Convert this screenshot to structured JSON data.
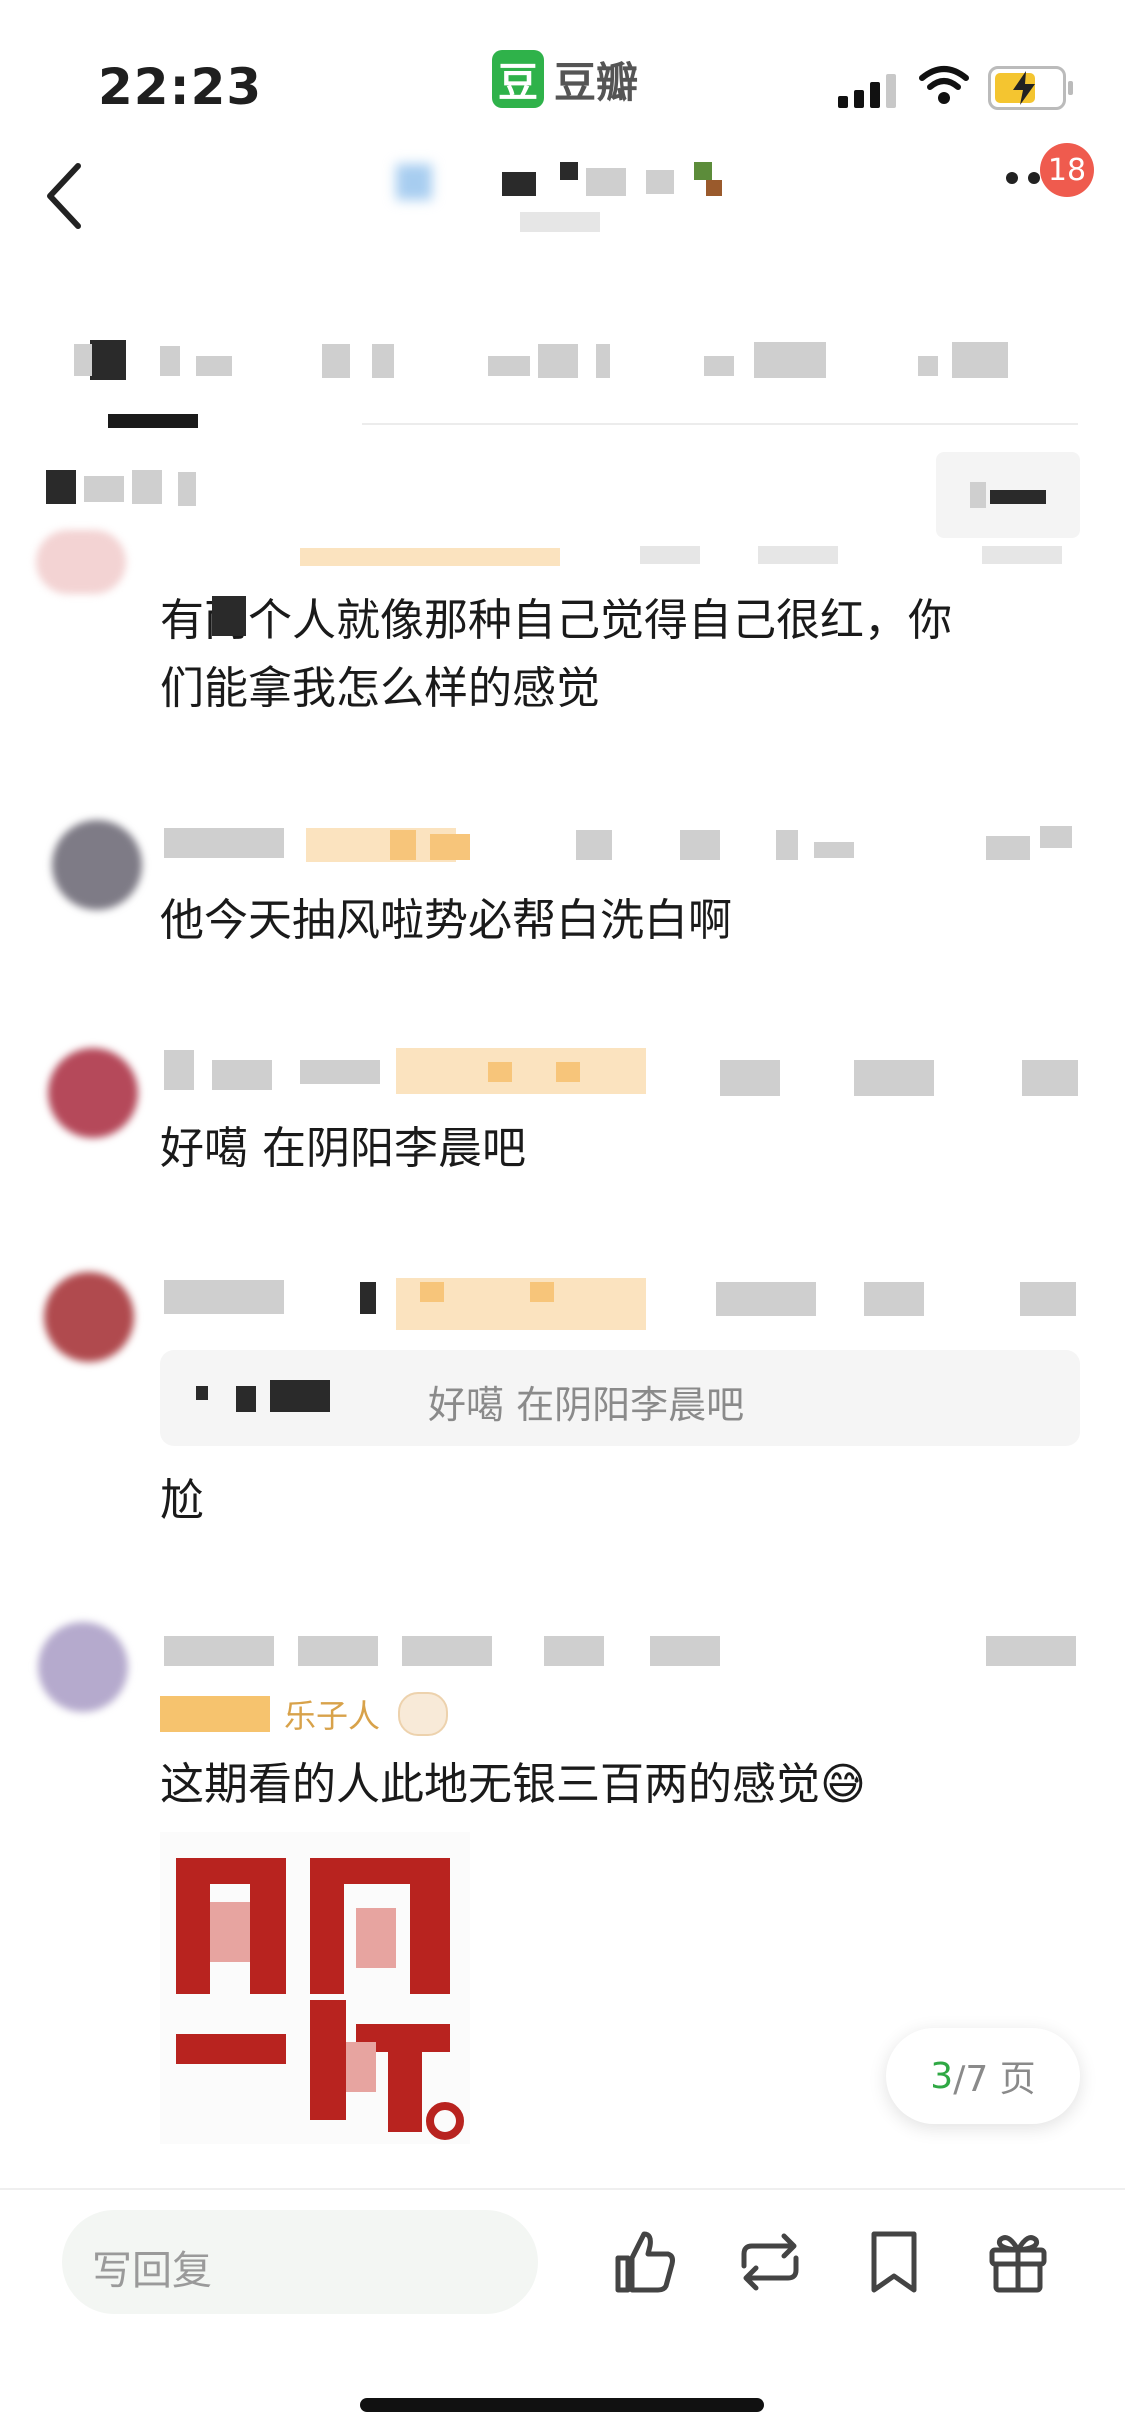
{
  "status_bar": {
    "time": "22:23",
    "brand_logo_char": "豆",
    "brand_name": "豆瓣"
  },
  "nav": {
    "notification_count": "18"
  },
  "comments": [
    {
      "text_line1": "有两个人就像那种自己觉得自己很红，你",
      "text_line2": "们能拿我怎么样的感觉"
    },
    {
      "text": "他今天抽风啦势必帮白洗白啊"
    },
    {
      "text": "好噶 在阴阳李晨吧"
    },
    {
      "quote": "好噶 在阴阳李晨吧",
      "text": "尬"
    },
    {
      "badge": "乐子人",
      "text": "这期看的人此地无银三百两的感觉😅"
    }
  ],
  "pagination": {
    "current": "3",
    "total_suffix": "/7 页"
  },
  "bottom_bar": {
    "reply_placeholder": "写回复"
  },
  "colors": {
    "brand_green": "#2fb24a",
    "badge_red": "#ef5b4e",
    "page_green": "#2fa844"
  },
  "icons": [
    "back-chevron-icon",
    "more-icon",
    "like-icon",
    "repost-icon",
    "bookmark-icon",
    "gift-icon"
  ]
}
